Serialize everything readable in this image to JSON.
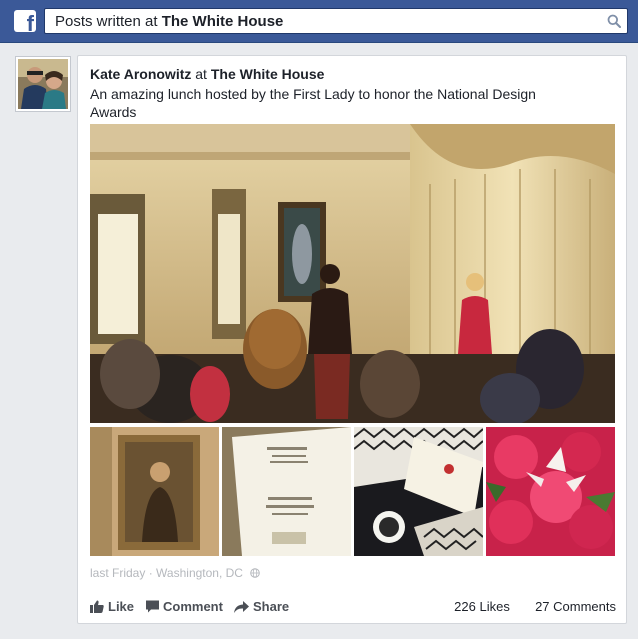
{
  "header": {
    "logo_letter": "f",
    "search_prefix": "Posts written at",
    "search_place": "The White House",
    "brand_color": "#3b5998"
  },
  "post": {
    "author": "Kate Aronowitz",
    "at": "at",
    "place": "The White House",
    "text": "An amazing lunch hosted by the First Lady to honor the National Design Awards",
    "time": "last Friday",
    "separator": "·",
    "location": "Washington, DC",
    "privacy_icon": "globe-icon"
  },
  "actions": {
    "like": "Like",
    "comment": "Comment",
    "share": "Share"
  },
  "counts": {
    "likes": "226 Likes",
    "comments": "27 Comments"
  },
  "photos": {
    "main": "event-photo",
    "thumbs": [
      "portrait-painting-photo",
      "program-card-photo",
      "place-card-photo",
      "flowers-photo"
    ]
  }
}
